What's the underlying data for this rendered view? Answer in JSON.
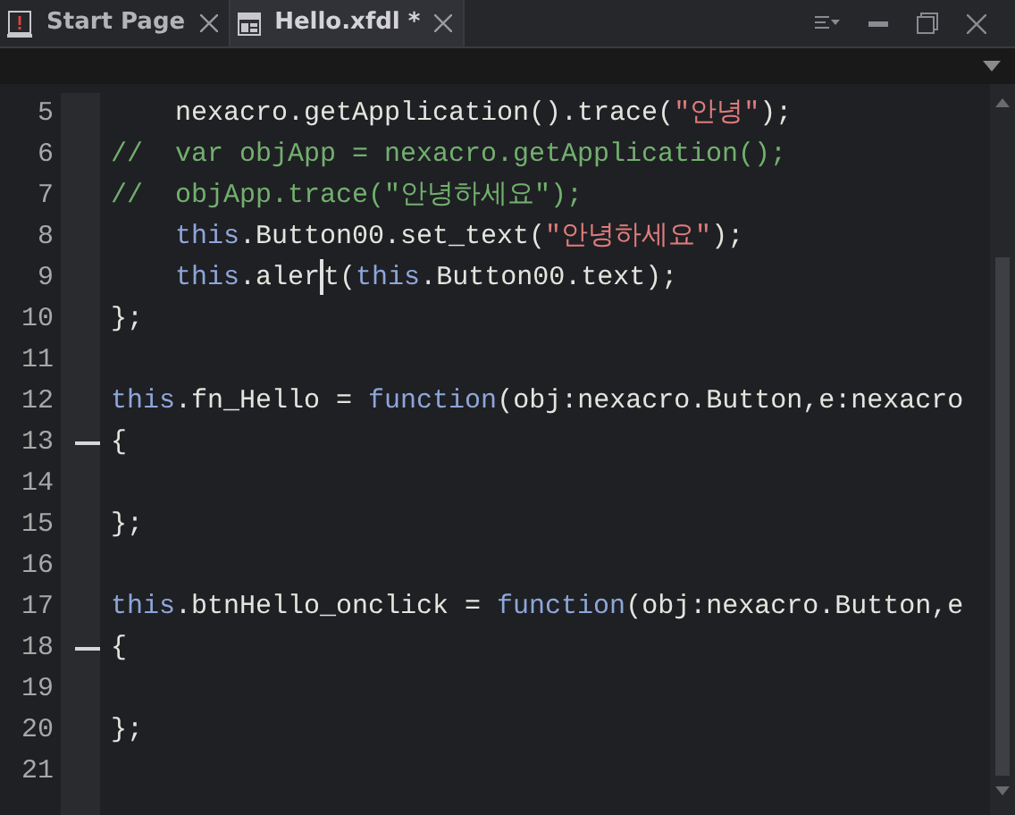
{
  "tabs": [
    {
      "label": "Start Page",
      "selected": false
    },
    {
      "label": "Hello.xfdl *",
      "selected": true
    }
  ],
  "editor": {
    "lines": [
      {
        "number": "5",
        "fold": false,
        "tokens": [
          {
            "kind": "plain",
            "text": "    nexacro.getApplication().trace("
          },
          {
            "kind": "string",
            "text": "\"안녕\""
          },
          {
            "kind": "plain",
            "text": ");"
          }
        ]
      },
      {
        "number": "6",
        "fold": false,
        "tokens": [
          {
            "kind": "comment",
            "text": "//  var objApp = nexacro.getApplication();"
          }
        ]
      },
      {
        "number": "7",
        "fold": false,
        "tokens": [
          {
            "kind": "comment",
            "text": "//  objApp.trace(\"안녕하세요\");"
          }
        ]
      },
      {
        "number": "8",
        "fold": false,
        "tokens": [
          {
            "kind": "keyword",
            "text": "    this"
          },
          {
            "kind": "plain",
            "text": ".Button00.set_text("
          },
          {
            "kind": "string",
            "text": "\"안녕하세요\""
          },
          {
            "kind": "plain",
            "text": ");"
          }
        ]
      },
      {
        "number": "9",
        "fold": false,
        "tokens": [
          {
            "kind": "keyword",
            "text": "    this"
          },
          {
            "kind": "plain",
            "text": ".aler"
          },
          {
            "kind": "cursor"
          },
          {
            "kind": "plain",
            "text": "t("
          },
          {
            "kind": "keyword",
            "text": "this"
          },
          {
            "kind": "plain",
            "text": ".Button00.text);"
          }
        ]
      },
      {
        "number": "10",
        "fold": false,
        "tokens": [
          {
            "kind": "plain",
            "text": "};"
          }
        ]
      },
      {
        "number": "11",
        "fold": false
      },
      {
        "number": "12",
        "fold": false,
        "tokens": [
          {
            "kind": "keyword",
            "text": "this"
          },
          {
            "kind": "plain",
            "text": ".fn_Hello = "
          },
          {
            "kind": "keyword",
            "text": "function"
          },
          {
            "kind": "plain",
            "text": "(obj:nexacro.Button,e:nexacro"
          }
        ]
      },
      {
        "number": "13",
        "fold": true,
        "tokens": [
          {
            "kind": "plain",
            "text": "{"
          }
        ]
      },
      {
        "number": "14",
        "fold": false
      },
      {
        "number": "15",
        "fold": false,
        "tokens": [
          {
            "kind": "plain",
            "text": "};"
          }
        ]
      },
      {
        "number": "16",
        "fold": false
      },
      {
        "number": "17",
        "fold": false,
        "tokens": [
          {
            "kind": "keyword",
            "text": "this"
          },
          {
            "kind": "plain",
            "text": ".btnHello_onclick = "
          },
          {
            "kind": "keyword",
            "text": "function"
          },
          {
            "kind": "plain",
            "text": "(obj:nexacro.Button,e"
          }
        ]
      },
      {
        "number": "18",
        "fold": true,
        "tokens": [
          {
            "kind": "plain",
            "text": "{"
          }
        ]
      },
      {
        "number": "19",
        "fold": false
      },
      {
        "number": "20",
        "fold": false,
        "tokens": [
          {
            "kind": "plain",
            "text": "};"
          }
        ]
      },
      {
        "number": "21",
        "fold": false
      }
    ]
  }
}
